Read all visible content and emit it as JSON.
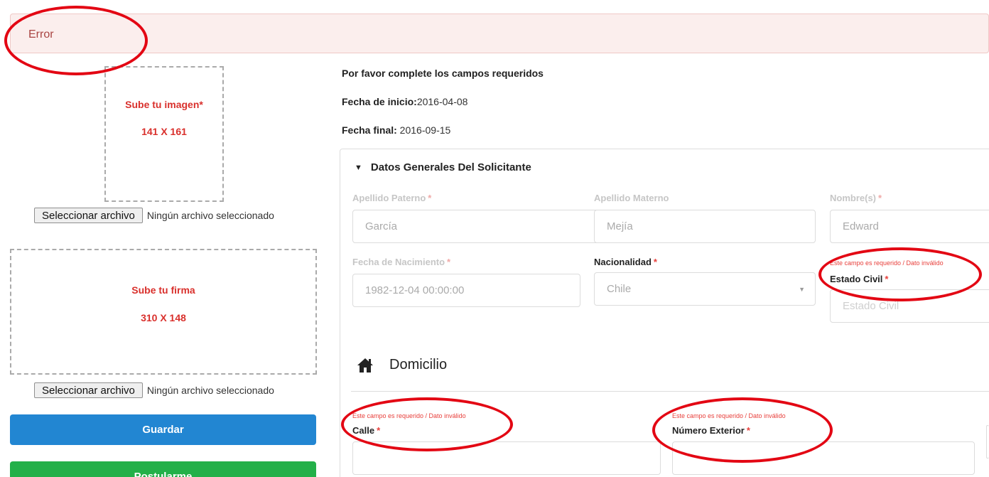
{
  "alert": {
    "title": "Error"
  },
  "photo_upload": {
    "title": "Sube tu imagen*",
    "size": "141 X 161",
    "button": "Seleccionar archivo",
    "status": "Ningún archivo seleccionado"
  },
  "signature_upload": {
    "title": "Sube tu firma",
    "size": "310 X 148",
    "button": "Seleccionar archivo",
    "status": "Ningún archivo seleccionado"
  },
  "actions": {
    "save": "Guardar",
    "apply": "Postularme"
  },
  "info": {
    "message": "Por favor complete los campos requeridos",
    "start_label": "Fecha de inicio:",
    "start_value": "2016-04-08",
    "end_label": "Fecha final:",
    "end_value": " 2016-09-15"
  },
  "general": {
    "section_title": "Datos Generales Del Solicitante",
    "apellido_paterno": {
      "label": "Apellido Paterno",
      "value": "García"
    },
    "apellido_materno": {
      "label": "Apellido Materno",
      "value": "Mejía"
    },
    "nombres": {
      "label": "Nombre(s)",
      "value": "Edward"
    },
    "fecha_nacimiento": {
      "label": "Fecha de Nacimiento",
      "value": "1982-12-04 00:00:00"
    },
    "nacionalidad": {
      "label": "Nacionalidad",
      "value": "Chile"
    },
    "estado_civil": {
      "label": "Estado Civil",
      "placeholder": "Estado Civil",
      "error": "Este campo es requerido / Dato inválido"
    }
  },
  "domicilio": {
    "title": "Domicilio",
    "calle": {
      "label": "Calle",
      "error": "Este campo es requerido / Dato inválido"
    },
    "numero_exterior": {
      "label": "Número Exterior",
      "error": "Este campo es requerido / Dato inválido"
    }
  },
  "required_mark": "*",
  "colors": {
    "annotation": "#e30613",
    "error_text": "#e8403c",
    "save": "#2286d2",
    "apply": "#23b049"
  },
  "icons": {
    "toggle": "caret-down-icon",
    "home": "home-icon"
  }
}
